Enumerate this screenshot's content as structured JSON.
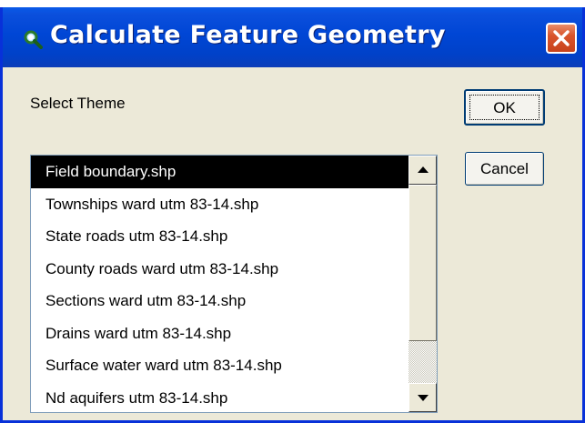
{
  "dialog": {
    "title": "Calculate Feature Geometry",
    "icons": {
      "app": "magnifier-icon",
      "close": "close-icon"
    },
    "colors": {
      "titlebar": "#0046d5",
      "close": "#d9552c",
      "body": "#ece9d8",
      "selection": "#000000"
    }
  },
  "form": {
    "select_theme_label": "Select Theme",
    "ok_label": "OK",
    "cancel_label": "Cancel"
  },
  "themes": {
    "items": [
      {
        "label": "Field boundary.shp",
        "selected": true
      },
      {
        "label": "Townships ward utm 83-14.shp",
        "selected": false
      },
      {
        "label": "State roads utm 83-14.shp",
        "selected": false
      },
      {
        "label": "County roads ward utm 83-14.shp",
        "selected": false
      },
      {
        "label": "Sections ward utm 83-14.shp",
        "selected": false
      },
      {
        "label": "Drains ward utm 83-14.shp",
        "selected": false
      },
      {
        "label": "Surface water ward utm 83-14.shp",
        "selected": false
      },
      {
        "label": "Nd aquifers utm 83-14.shp",
        "selected": false
      }
    ],
    "scroll_icons": {
      "up": "arrow-up-icon",
      "down": "arrow-down-icon"
    }
  }
}
